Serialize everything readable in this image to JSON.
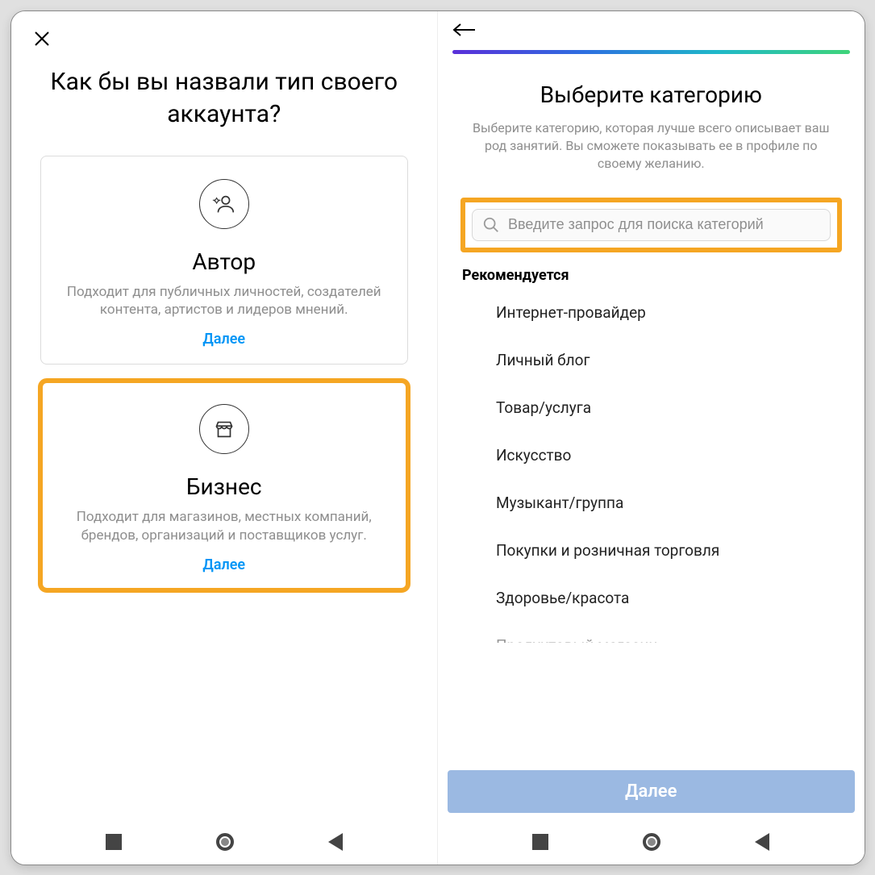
{
  "left": {
    "title": "Как бы вы назвали тип своего аккаунта?",
    "cards": [
      {
        "icon": "creator-icon",
        "title": "Автор",
        "desc": "Подходит для публичных личностей, создателей контента, артистов и лидеров мнений.",
        "next": "Далее"
      },
      {
        "icon": "store-icon",
        "title": "Бизнес",
        "desc": "Подходит для магазинов, местных компаний, брендов, организаций и поставщиков услуг.",
        "next": "Далее"
      }
    ]
  },
  "right": {
    "title": "Выберите категорию",
    "sub": "Выберите категорию, которая лучше всего описывает ваш род занятий. Вы сможете показывать ее в профиле по своему желанию.",
    "search_placeholder": "Введите запрос для поиска категорий",
    "rec_label": "Рекомендуется",
    "categories": [
      "Интернет-провайдер",
      "Личный блог",
      "Товар/услуга",
      "Искусство",
      "Музыкант/группа",
      "Покупки и розничная торговля",
      "Здоровье/красота",
      "Продуктовый магазин"
    ],
    "next_btn": "Далее"
  }
}
